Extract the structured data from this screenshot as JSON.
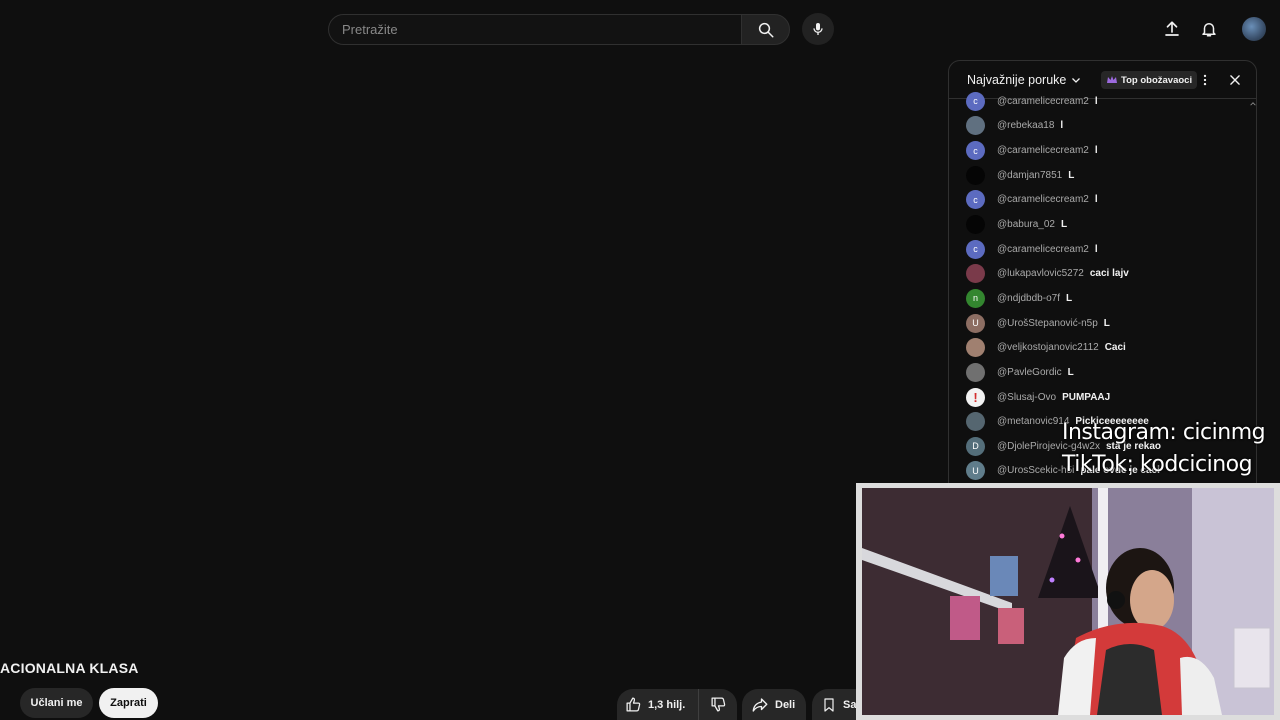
{
  "search": {
    "placeholder": "Pretražite"
  },
  "chat": {
    "mode_label": "Najvažnije poruke",
    "badge_label": "Top obožavaoci",
    "messages": [
      {
        "author": "@caramelicecream2",
        "text": "l",
        "avatar_letter": "c",
        "avatar_color": "#5c6bc0"
      },
      {
        "author": "@rebekaa18",
        "text": "l",
        "avatar_letter": "",
        "avatar_color": "#607080"
      },
      {
        "author": "@caramelicecream2",
        "text": "l",
        "avatar_letter": "c",
        "avatar_color": "#5c6bc0"
      },
      {
        "author": "@damjan7851",
        "text": "L",
        "avatar_letter": "",
        "avatar_color": "#050505"
      },
      {
        "author": "@caramelicecream2",
        "text": "l",
        "avatar_letter": "c",
        "avatar_color": "#5c6bc0"
      },
      {
        "author": "@babura_02",
        "text": "L",
        "avatar_letter": "",
        "avatar_color": "#050505"
      },
      {
        "author": "@caramelicecream2",
        "text": "l",
        "avatar_letter": "c",
        "avatar_color": "#5c6bc0"
      },
      {
        "author": "@lukapavlovic5272",
        "text": "caci lajv",
        "avatar_letter": "",
        "avatar_color": "#7a3a4a"
      },
      {
        "author": "@ndjdbdb-o7f",
        "text": "L",
        "avatar_letter": "n",
        "avatar_color": "#33862f"
      },
      {
        "author": "@UrošStepanović-n5p",
        "text": "L",
        "avatar_letter": "U",
        "avatar_color": "#8d6e63"
      },
      {
        "author": "@veljkostojanovic2112",
        "text": "Caci",
        "avatar_letter": "",
        "avatar_color": "#a08070"
      },
      {
        "author": "@PavleGordic",
        "text": "L",
        "avatar_letter": "",
        "avatar_color": "#707070"
      },
      {
        "author": "@Slusaj-Ovo",
        "text": "PUMPAAJ",
        "avatar_letter": "!",
        "avatar_color": "#f2f2f2"
      },
      {
        "author": "@metanovic914",
        "text": "Pickiceeeeeeee",
        "avatar_letter": "",
        "avatar_color": "#556670"
      },
      {
        "author": "@DjolePirojevic-g4w2x",
        "text": "sta je rekao",
        "avatar_letter": "D",
        "avatar_color": "#546e7a"
      },
      {
        "author": "@UrosScekic-h5i",
        "text": "pale ovde je caci",
        "avatar_letter": "U",
        "avatar_color": "#607d8b"
      }
    ]
  },
  "overlay": {
    "instagram": "Instagram: cicinmg",
    "tiktok": "TikTok: kodcicinog"
  },
  "channel": {
    "name": "ACIONALNA KLASA"
  },
  "actions": {
    "join_label": "Učlani me",
    "subscribe_label": "Zaprati",
    "like_count": "1,3 hilj.",
    "share_label": "Deli",
    "save_label": "Sačuvaj"
  }
}
